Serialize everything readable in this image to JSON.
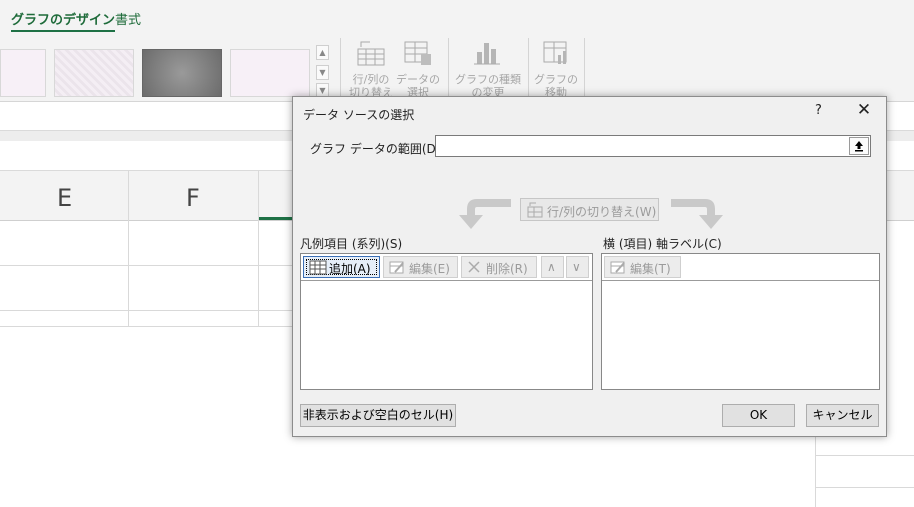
{
  "ribbon": {
    "tabs": [
      {
        "label": "グラフのデザイン",
        "active": true
      },
      {
        "label": "書式",
        "active": false
      }
    ],
    "commands": [
      {
        "label": "行/列の切り替え"
      },
      {
        "label": "データの選択"
      },
      {
        "label": "グラフの種類の変更"
      },
      {
        "label": "グラフの移動"
      }
    ]
  },
  "sheet": {
    "columns": [
      "E",
      "F"
    ]
  },
  "dialog": {
    "title": "データ ソースの選択",
    "help": "?",
    "close": "✕",
    "range_label": "グラフ データの範囲(D):",
    "range_value": "",
    "switch_label": "行/列の切り替え(W)",
    "legend_group_label": "凡例項目 (系列)(S)",
    "axis_group_label": "横 (項目) 軸ラベル(C)",
    "legend_buttons": {
      "add": "追加(A)",
      "edit": "編集(E)",
      "delete": "削除(R)",
      "up": "∧",
      "down": "∨"
    },
    "axis_buttons": {
      "edit": "編集(T)"
    },
    "hidden_cells_button": "非表示および空白のセル(H)",
    "ok": "OK",
    "cancel": "キャンセル"
  },
  "colors": {
    "accent": "#1e7145",
    "dialog_bg": "#f0f0f0",
    "disabled_text": "#9b9b9b"
  }
}
